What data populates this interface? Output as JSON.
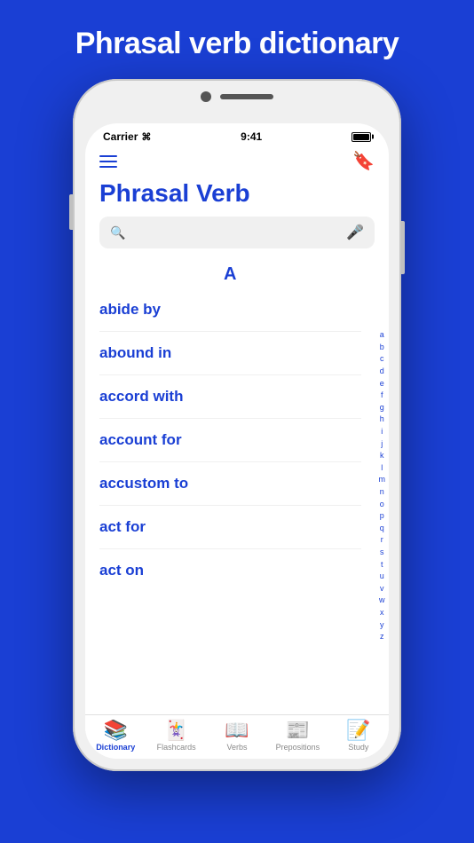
{
  "page": {
    "background_color": "#1a3fd4",
    "title": "Phrasal verb dictionary"
  },
  "status_bar": {
    "carrier": "Carrier",
    "time": "9:41"
  },
  "app": {
    "title": "Phrasal Verb",
    "search_placeholder": ""
  },
  "word_list": {
    "section_letter": "A",
    "words": [
      "abide by",
      "abound in",
      "accord with",
      "account for",
      "accustom to",
      "act for",
      "act on"
    ]
  },
  "alphabet": [
    "a",
    "b",
    "c",
    "d",
    "e",
    "f",
    "g",
    "h",
    "i",
    "j",
    "k",
    "l",
    "m",
    "n",
    "o",
    "p",
    "q",
    "r",
    "s",
    "t",
    "u",
    "v",
    "w",
    "x",
    "y",
    "z"
  ],
  "tabs": [
    {
      "id": "dictionary",
      "label": "Dictionary",
      "icon": "📚",
      "active": true
    },
    {
      "id": "flashcards",
      "label": "Flashcards",
      "icon": "🃏",
      "active": false
    },
    {
      "id": "verbs",
      "label": "Verbs",
      "icon": "📖",
      "active": false
    },
    {
      "id": "prepositions",
      "label": "Prepositions",
      "icon": "📰",
      "active": false
    },
    {
      "id": "study",
      "label": "Study",
      "icon": "📝",
      "active": false
    }
  ]
}
